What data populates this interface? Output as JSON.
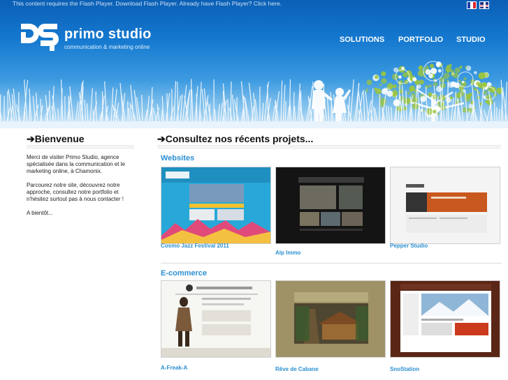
{
  "header": {
    "flash_message": "This content requires the Flash Player. Download Flash Player. Already have Flash Player? Click here.",
    "brand_name": "primo studio",
    "brand_tagline": "communication & marketing online",
    "nav": [
      "SOLUTIONS",
      "PORTFOLIO",
      "STUDIO"
    ],
    "languages": [
      "fr-flag",
      "uk-flag"
    ]
  },
  "left": {
    "title": "Bienvenue",
    "paragraphs": [
      "Merci de visiter Primo Studio, agence spécialisée dans la communication et le marketing online, à Chamonix.",
      "Parcourez notre site, découvrez notre approche, consultez notre portfolio et n'hésitez surtout pas à nous contacter !",
      "A bientôt..."
    ]
  },
  "main": {
    "title": "Consultez nos récents projets...",
    "sections": [
      {
        "title": "Websites",
        "projects": [
          "Cosmo Jazz Festival 2011",
          "Alp Immo",
          "Pepper Studio"
        ]
      },
      {
        "title": "E-commerce",
        "projects": [
          "A-Freak-A",
          "Rêve de Cabane",
          "SnoStation"
        ]
      }
    ]
  },
  "colors": {
    "sky_top": "#0b5fb5",
    "sky_bottom": "#cfe6f7",
    "accent_blue": "#2a8fd0",
    "tree_green": "#9bc53d"
  },
  "icons": [
    "arrow-right-icon",
    "primo-logo-icon",
    "fr-flag-icon",
    "uk-flag-icon"
  ]
}
